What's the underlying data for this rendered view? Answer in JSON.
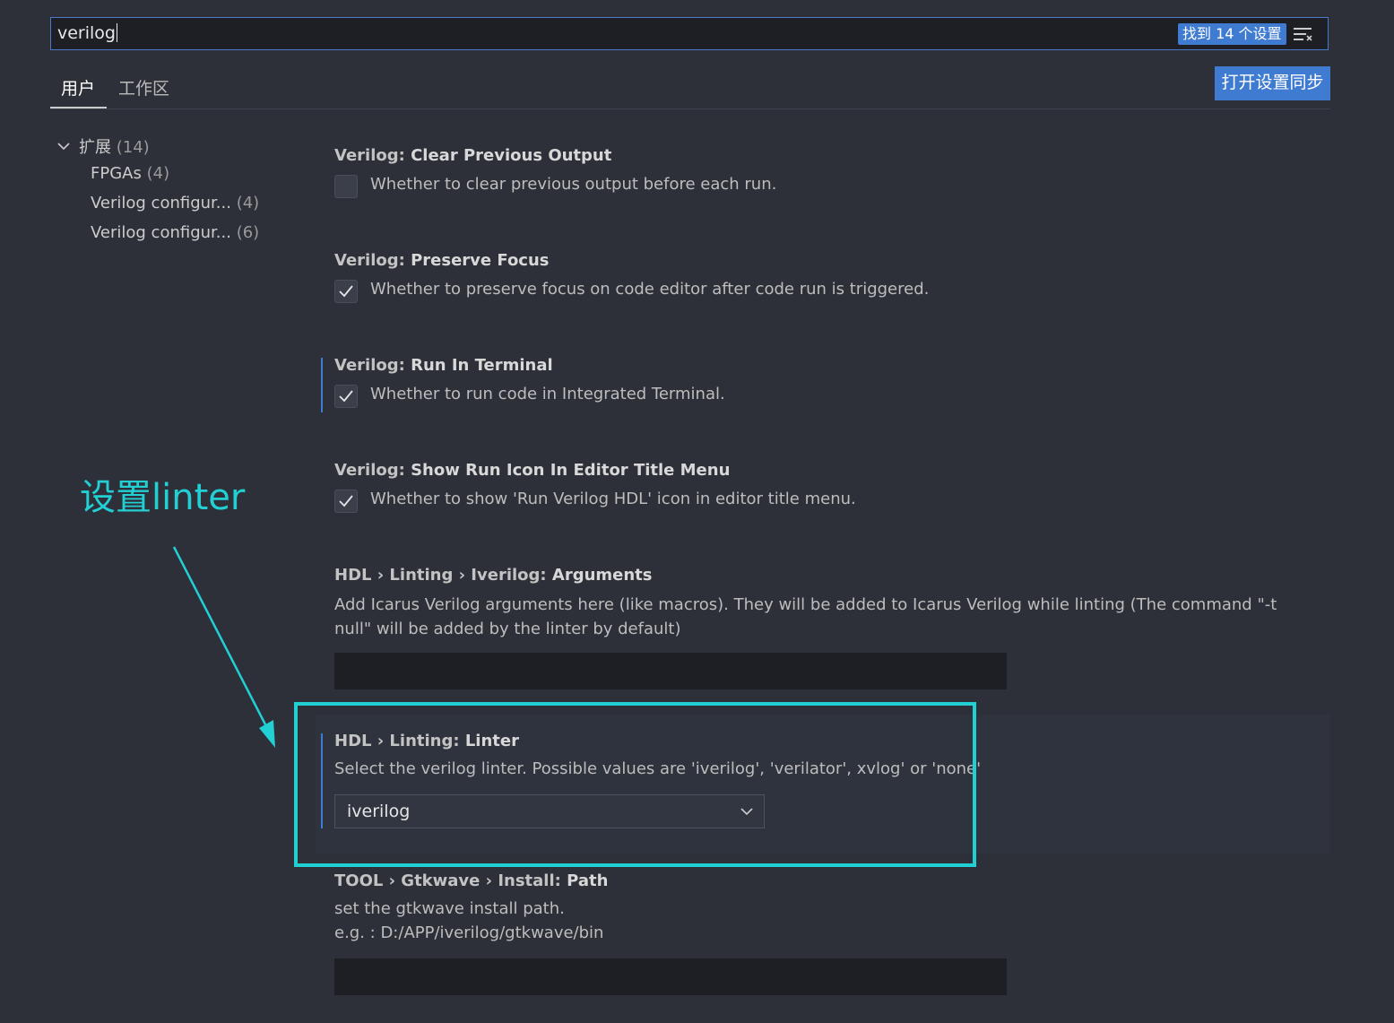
{
  "search": {
    "value": "verilog",
    "found_label": "找到 14 个设置"
  },
  "tabs": {
    "user": "用户",
    "workspace": "工作区"
  },
  "sync_button": "打开设置同步",
  "toc": {
    "root": {
      "label": "扩展",
      "count": "(14)"
    },
    "items": [
      {
        "label": "FPGAs",
        "count": "(4)"
      },
      {
        "label": "Verilog configur...",
        "count": "(4)"
      },
      {
        "label": "Verilog configur...",
        "count": "(6)"
      }
    ]
  },
  "settings": [
    {
      "category": "Verilog: ",
      "name": "Clear Previous Output",
      "desc": "Whether to clear previous output before each run.",
      "checked": false
    },
    {
      "category": "Verilog: ",
      "name": "Preserve Focus",
      "desc": "Whether to preserve focus on code editor after code run is triggered.",
      "checked": true
    },
    {
      "category": "Verilog: ",
      "name": "Run In Terminal",
      "desc": "Whether to run code in Integrated Terminal.",
      "checked": true
    },
    {
      "category": "Verilog: ",
      "name": "Show Run Icon In Editor Title Menu",
      "desc": "Whether to show 'Run Verilog HDL' icon in editor title menu.",
      "checked": true
    },
    {
      "category": "HDL › Linting › Iverilog: ",
      "name": "Arguments",
      "desc": "Add Icarus Verilog arguments here (like macros). They will be added to Icarus Verilog while linting (The command \"-t null\" will be added by the linter by default)",
      "value": ""
    },
    {
      "category": "HDL › Linting: ",
      "name": "Linter",
      "desc": "Select the verilog linter. Possible values are 'iverilog', 'verilator', xvlog' or 'none'",
      "value": "iverilog"
    },
    {
      "category": "TOOL › Gtkwave › Install: ",
      "name": "Path",
      "desc": "set the gtkwave install path.",
      "desc2": "e.g. : D:/APP/iverilog/gtkwave/bin",
      "value": ""
    }
  ],
  "annotation": {
    "label": "设置linter"
  },
  "colors": {
    "accent": "#3f7bd1",
    "annotation": "#22d0d4",
    "background": "#2d3039"
  },
  "icons": {
    "filter": "filter-clear-icon",
    "check": "check-icon",
    "chevron": "chevron-down-icon"
  }
}
